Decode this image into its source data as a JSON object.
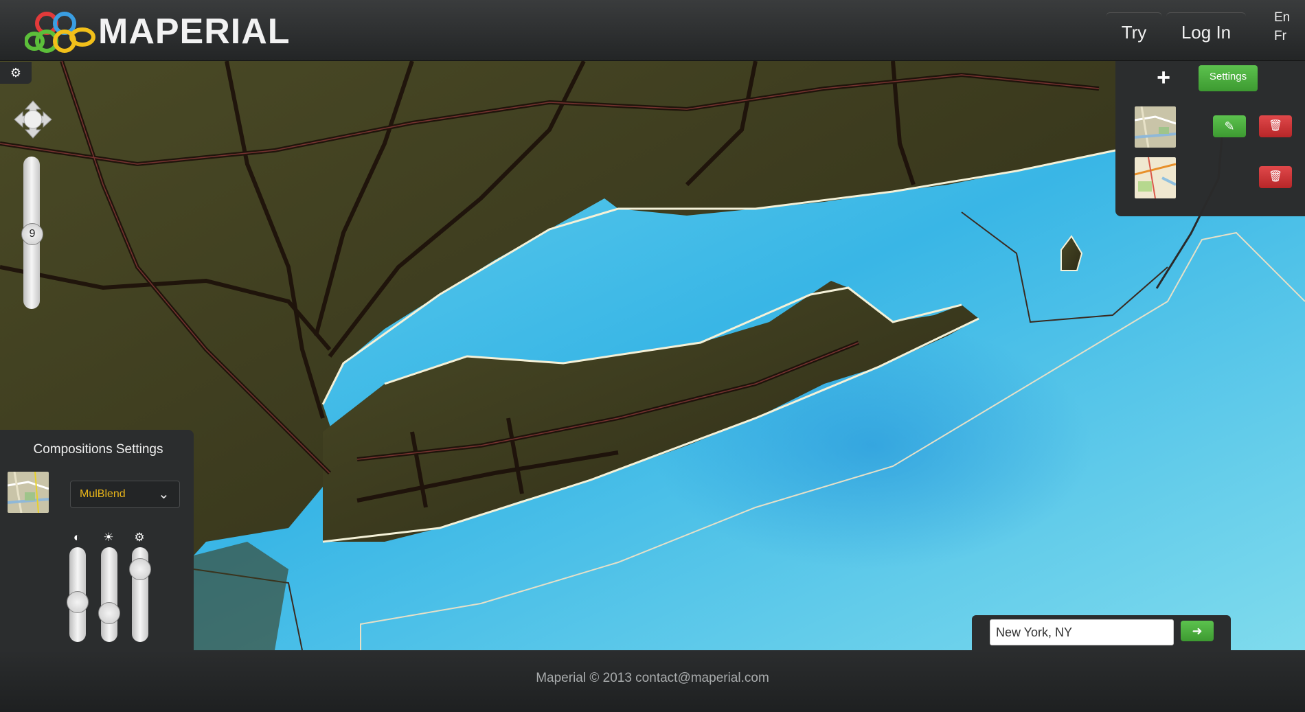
{
  "header": {
    "brand": "MAPERIAL",
    "nav": {
      "try_label": "Try",
      "login_label": "Log In"
    },
    "languages": [
      "En",
      "Fr"
    ]
  },
  "map_controls": {
    "settings_icon": "gear-icon",
    "zoom_level": "9"
  },
  "layers_panel": {
    "add_icon": "plus-icon",
    "settings_label": "Settings",
    "edit_icon": "edit-icon",
    "delete_icon": "trash-icon"
  },
  "compositions": {
    "title": "Compositions Settings",
    "blend_mode": "MulBlend",
    "sliders": [
      {
        "icon": "contrast-icon",
        "value": 0.4
      },
      {
        "icon": "brightness-icon",
        "value": 0.25
      },
      {
        "icon": "gear-icon",
        "value": 0.85
      }
    ]
  },
  "search": {
    "value": "New York, NY",
    "go_icon": "arrow-right-icon"
  },
  "footer": {
    "text": "Maperial © 2013 contact@maperial.com"
  },
  "colors": {
    "green_button": "#4aab3c",
    "red_button": "#c93234",
    "panel_bg": "#2b2d2e",
    "water": "#5cc9e8",
    "land": "#3a3a1e"
  }
}
